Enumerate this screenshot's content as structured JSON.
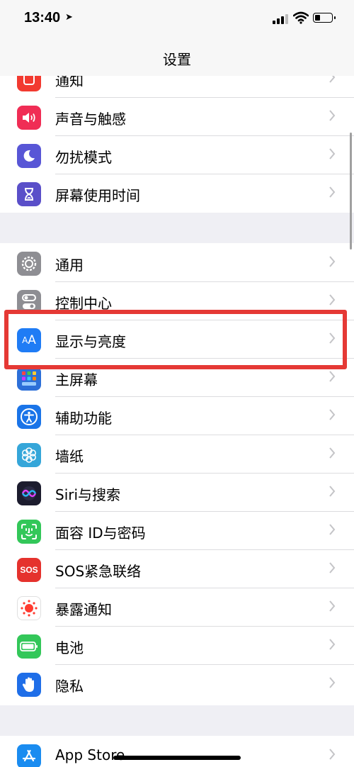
{
  "status_bar": {
    "time": "13:40"
  },
  "nav": {
    "title": "设置"
  },
  "groups": [
    {
      "items": [
        {
          "label": "通知",
          "icon": "notifications-icon",
          "color": "#f23a30"
        },
        {
          "label": "声音与触感",
          "icon": "sounds-icon",
          "color": "#f02d55"
        },
        {
          "label": "勿扰模式",
          "icon": "moon-icon",
          "color": "#5856d6"
        },
        {
          "label": "屏幕使用时间",
          "icon": "hourglass-icon",
          "color": "#5a4fc9"
        }
      ]
    },
    {
      "items": [
        {
          "label": "通用",
          "icon": "gear-icon",
          "color": "#8e8e93"
        },
        {
          "label": "控制中心",
          "icon": "toggles-icon",
          "color": "#8e8e93"
        },
        {
          "label": "显示与亮度",
          "icon": "display-aa-icon",
          "color": "#1f7cf5"
        },
        {
          "label": "主屏幕",
          "icon": "home-screen-icon",
          "color": "#2c6fd8"
        },
        {
          "label": "辅助功能",
          "icon": "accessibility-icon",
          "color": "#1a74e8"
        },
        {
          "label": "墙纸",
          "icon": "flower-icon",
          "color": "#35a6d9"
        },
        {
          "label": "Siri与搜索",
          "icon": "siri-icon",
          "color": "#1c1c2e"
        },
        {
          "label": "面容 ID与密码",
          "icon": "face-id-icon",
          "color": "#33c759"
        },
        {
          "label": "SOS紧急联络",
          "icon": "sos-icon",
          "color": "#e5322d",
          "icon_text": "SOS"
        },
        {
          "label": "暴露通知",
          "icon": "exposure-icon",
          "color": "#ffffff"
        },
        {
          "label": "电池",
          "icon": "battery-icon",
          "color": "#33c759"
        },
        {
          "label": "隐私",
          "icon": "hand-icon",
          "color": "#1f6ee8"
        }
      ]
    },
    {
      "items": [
        {
          "label": "App Store",
          "icon": "app-store-icon",
          "color": "#1a8cf0"
        }
      ]
    }
  ]
}
